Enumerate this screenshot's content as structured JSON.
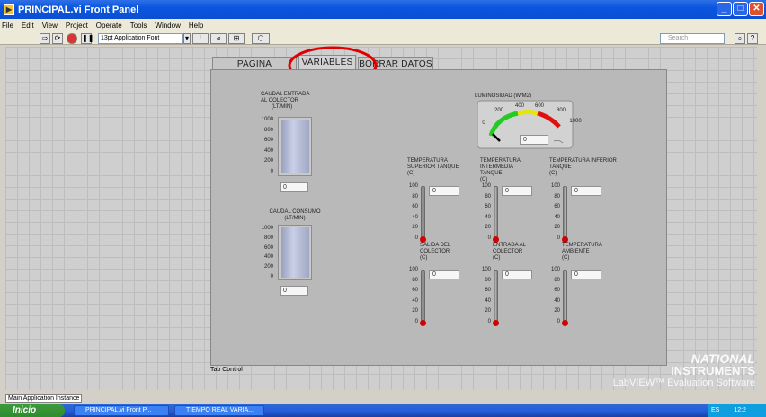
{
  "window": {
    "title": "PRINCIPAL.vi Front Panel"
  },
  "menu": [
    "File",
    "Edit",
    "View",
    "Project",
    "Operate",
    "Tools",
    "Window",
    "Help"
  ],
  "toolbar": {
    "font": "13pt Application Font",
    "search_placeholder": "Search"
  },
  "tabs": {
    "items": [
      "PAGINA PRINCIPAL",
      "VARIABLES",
      "BORRAR DATOS"
    ],
    "active": "VARIABLES",
    "control_label": "Tab Control"
  },
  "annotation_color": "#e00000",
  "caudal_entrada": {
    "label": "CAUDAL ENTRADA AL COLECTOR (LT/MIN)",
    "l1": "CAUDAL ENTRADA",
    "l2": "AL COLECTOR",
    "l3": "(LT/MIN)",
    "ticks": [
      "1000",
      "800",
      "600",
      "400",
      "200",
      "0"
    ],
    "value": "0"
  },
  "caudal_consumo": {
    "l1": "CAUDAL CONSUMO",
    "l2": "(LT/MIN)",
    "ticks": [
      "1000",
      "800",
      "600",
      "400",
      "200",
      "0"
    ],
    "value": "0"
  },
  "luminosidad": {
    "label": "LUMINOSIDAD (W/M2)",
    "ticks": [
      "0",
      "200",
      "400",
      "600",
      "800",
      "1000"
    ],
    "value": "0"
  },
  "thermo_ticks": [
    "100",
    "80",
    "60",
    "40",
    "20",
    "0"
  ],
  "thermometers": [
    {
      "l1": "TEMPERATURA",
      "l2": "SUPERIOR TANQUE",
      "l3": "(C)",
      "value": "0"
    },
    {
      "l1": "TEMPERATURA INTERMEDIA",
      "l2": "TANQUE",
      "l3": "(C)",
      "value": "0"
    },
    {
      "l1": "TEMPERATURA INFERIOR",
      "l2": "TANQUE",
      "l3": "(C)",
      "value": "0"
    },
    {
      "l1": "SALIDA DEL",
      "l2": "COLECTOR",
      "l3": "(C)",
      "value": "0"
    },
    {
      "l1": "ENTRADA AL",
      "l2": "COLECTOR",
      "l3": "(C)",
      "value": "0"
    },
    {
      "l1": "TEMPERATURA",
      "l2": "AMBIENTE",
      "l3": "(C)",
      "value": "0"
    }
  ],
  "watermark": {
    "l1": "NATIONAL",
    "l2": "INSTRUMENTS",
    "l3": "LabVIEW™ Evaluation Software"
  },
  "status": {
    "instance": "Main Application Instance"
  },
  "taskbar": {
    "start": "Inicio",
    "tasks": [
      "PRINCIPAL.vi Front P...",
      "TIEMPO REAL VARIA..."
    ],
    "tray": "ES",
    "time": "12:2"
  }
}
